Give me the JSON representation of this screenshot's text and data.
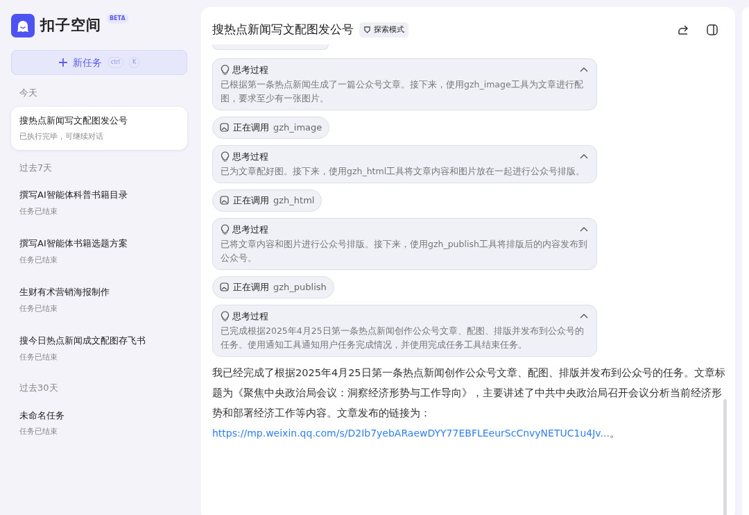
{
  "sidebar": {
    "brand": "扣子空间",
    "brand_badge": "BETA",
    "new_task": {
      "label": "新任务",
      "keys": [
        "ctrl",
        "K"
      ]
    },
    "groups": [
      {
        "label": "今天",
        "items": [
          {
            "title": "搜热点新闻写文配图发公号",
            "status": "已执行完毕，可继续对话",
            "selected": true
          }
        ]
      },
      {
        "label": "过去7天",
        "items": [
          {
            "title": "撰写AI智能体科普书籍目录",
            "status": "任务已结束",
            "selected": false
          },
          {
            "title": "撰写AI智能体书籍选题方案",
            "status": "任务已结束",
            "selected": false
          },
          {
            "title": "生财有术营销海报制作",
            "status": "任务已结束",
            "selected": false
          },
          {
            "title": "搜今日热点新闻成文配图存飞书",
            "status": "任务已结束",
            "selected": false
          }
        ]
      },
      {
        "label": "过去30天",
        "items": [
          {
            "title": "未命名任务",
            "status": "任务已结束",
            "selected": false
          }
        ]
      }
    ]
  },
  "header": {
    "title": "搜热点新闻写文配图发公号",
    "mode_badge": "探索模式"
  },
  "messages": [
    {
      "kind": "thinking",
      "title": "思考过程",
      "expanded": true,
      "text": "已根据第一条热点新闻生成了一篇公众号文章。接下来，使用gzh_image工具为文章进行配图，要求至少有一张图片。"
    },
    {
      "kind": "tool_call",
      "label": "正在调用",
      "tool": "gzh_image"
    },
    {
      "kind": "thinking",
      "title": "思考过程",
      "expanded": true,
      "text": "已为文章配好图。接下来，使用gzh_html工具将文章内容和图片放在一起进行公众号排版。"
    },
    {
      "kind": "tool_call",
      "label": "正在调用",
      "tool": "gzh_html"
    },
    {
      "kind": "thinking",
      "title": "思考过程",
      "expanded": true,
      "text": "已将文章内容和图片进行公众号排版。接下来，使用gzh_publish工具将排版后的内容发布到公众号。"
    },
    {
      "kind": "tool_call",
      "label": "正在调用",
      "tool": "gzh_publish"
    },
    {
      "kind": "thinking",
      "title": "思考过程",
      "expanded": true,
      "text": "已完成根据2025年4月25日第一条热点新闻创作公众号文章、配图、排版并发布到公众号的任务。使用通知工具通知用户任务完成情况，并使用完成任务工具结束任务。"
    }
  ],
  "answer": {
    "text": "我已经完成了根据2025年4月25日第一条热点新闻创作公众号文章、配图、排版并发布到公众号的任务。文章标题为《聚焦中央政治局会议：洞察经济形势与工作导向》，主要讲述了中共中央政治局召开会议分析当前经济形势和部署经济工作等内容。文章发布的链接为：",
    "link": "https://mp.weixin.qq.com/s/D2Ib7yebARaewDYY77EBFLEeurScCnvyNETUC1u4Jv...",
    "end": "。"
  }
}
